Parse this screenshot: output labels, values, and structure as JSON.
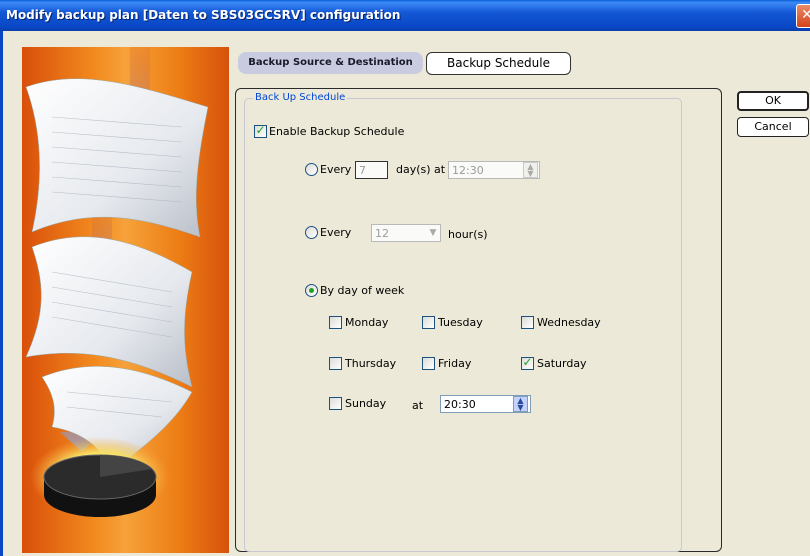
{
  "window": {
    "title": "Modify backup plan [Daten to SBS03GCSRV] configuration",
    "close_glyph": "✕"
  },
  "tabs": {
    "source": "Backup Source & Destination",
    "schedule": "Backup Schedule"
  },
  "buttons": {
    "ok": "OK",
    "cancel": "Cancel"
  },
  "group": {
    "title": "Back Up Schedule"
  },
  "schedule": {
    "enable_label": "Enable Backup Schedule",
    "enable_checked": true,
    "every_days": {
      "label": "Every",
      "value": "7",
      "unit": "day(s) at",
      "time": "12:30",
      "selected": false
    },
    "every_hours": {
      "label": "Every",
      "value": "12",
      "unit": "hour(s)",
      "selected": false
    },
    "by_day": {
      "label": "By day of week",
      "selected": true
    },
    "days": {
      "monday": "Monday",
      "tuesday": "Tuesday",
      "wednesday": "Wednesday",
      "thursday": "Thursday",
      "friday": "Friday",
      "saturday": "Saturday",
      "sunday": "Sunday"
    },
    "checked_days": [
      "Saturday"
    ],
    "at_label": "at",
    "time": "20:30"
  },
  "colors": {
    "title_bar": "#0846c4",
    "dialog_bg": "#ece9d8",
    "banner": "#f28a1e",
    "check": "#21a121",
    "group_title": "#0046d5"
  }
}
